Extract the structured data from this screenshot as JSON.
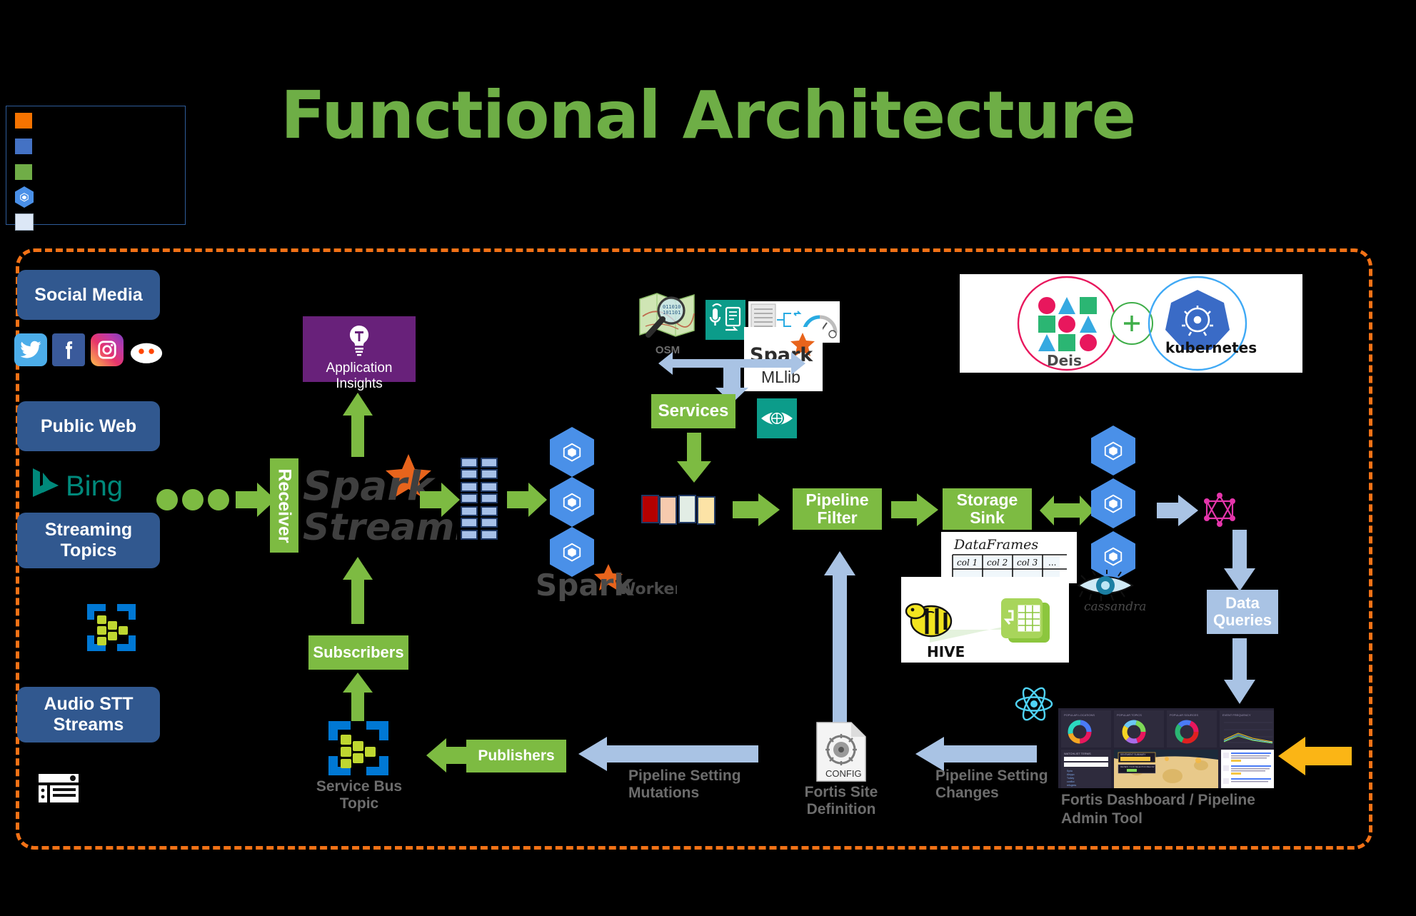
{
  "page": {
    "title": "Functional Architecture",
    "title_color": "#6EAE46",
    "background": "#000000",
    "boundary_color": "#F47216"
  },
  "legend": {
    "name": "legend-box",
    "border_color": "#2E5C9A",
    "swatches": [
      {
        "name": "legend-swatch-orange",
        "color": "#F57300",
        "shape": "square",
        "label": ""
      },
      {
        "name": "legend-swatch-blue",
        "color": "#4472C4",
        "shape": "square",
        "label": ""
      },
      {
        "name": "legend-swatch-green",
        "color": "#70AD47",
        "shape": "square",
        "label": ""
      },
      {
        "name": "legend-swatch-hexagon",
        "color": "#4A90E8",
        "shape": "hexagon",
        "label": ""
      },
      {
        "name": "legend-swatch-pale",
        "color": "#DCE7F6",
        "shape": "square",
        "label": ""
      }
    ]
  },
  "sources": {
    "social_media": {
      "label": "Social Media",
      "color": "#31588F"
    },
    "public_web": {
      "label": "Public Web",
      "color": "#31588F"
    },
    "streaming_topics": {
      "label": "Streaming Topics",
      "color": "#31588F"
    },
    "audio_stt": {
      "label": "Audio STT Streams",
      "color": "#31588F"
    },
    "social_icons": [
      {
        "name": "twitter-icon",
        "label": "Twitter",
        "color": "#4CADE9"
      },
      {
        "name": "facebook-icon",
        "label": "Facebook",
        "color": "#3A5A9B"
      },
      {
        "name": "instagram-icon",
        "label": "Instagram",
        "color": "#D6249F"
      },
      {
        "name": "reddit-icon",
        "label": "Reddit",
        "color": "#FF4500"
      }
    ],
    "bing": {
      "label": "Bing",
      "color": "#00897B"
    },
    "service_bus_icon": {
      "label": "Service Bus",
      "color": "#0078D4"
    },
    "radio_icon": {
      "label": "Radio / Audio Stream",
      "color": "#FFFFFF"
    }
  },
  "ingest": {
    "receiver": {
      "label": "Receiver",
      "color": "#7DBB42"
    },
    "spark_streaming": {
      "line1": "Spark",
      "line2": "Streaming"
    },
    "application_insights": {
      "label": "Application Insights",
      "color": "#68217A",
      "icon": "lightbulb-icon"
    },
    "subscribers": {
      "label": "Subscribers",
      "color": "#7DBB42"
    },
    "service_bus_topic": {
      "label": "Service Bus Topic"
    },
    "publishers": {
      "label": "Publishers",
      "color": "#7DBB42"
    },
    "spark_workers": {
      "label": "Workers",
      "brand": "Spark",
      "node_count": 3
    }
  },
  "services": {
    "box": {
      "label": "Services",
      "color": "#7DBB42"
    },
    "osm": {
      "label": "OSM",
      "name": "osm-map-icon"
    },
    "speech_to_text": {
      "name": "speech-to-text-icon",
      "color": "#0C9C8A"
    },
    "mllib": {
      "brand": "Spark",
      "label": "MLlib",
      "name": "spark-mllib-card"
    },
    "sentiment": {
      "name": "sentiment-gauge-icon"
    },
    "computer_vision": {
      "name": "computer-vision-eye-icon",
      "color": "#0C9C8A"
    }
  },
  "orchestration": {
    "deis": {
      "label": "Deis",
      "circle_color": "#E8175D"
    },
    "plus": {
      "label": "+",
      "color": "#3FAE49"
    },
    "kubernetes": {
      "label": "kubernetes",
      "circle_color": "#3FA9F5",
      "logo_color": "#3A6BC6"
    }
  },
  "processing": {
    "swatches": [
      {
        "name": "data-swatch-red",
        "color": "#B40000"
      },
      {
        "name": "data-swatch-peach",
        "color": "#F6CAAE"
      },
      {
        "name": "data-swatch-mint",
        "color": "#E2EDE5"
      },
      {
        "name": "data-swatch-yellow",
        "color": "#FCE3A6"
      }
    ],
    "pipeline_filter": {
      "label": "Pipeline Filter",
      "color": "#7DBB42"
    },
    "storage_sink": {
      "label": "Storage Sink",
      "color": "#7DBB42"
    },
    "dataframes": {
      "title": "DataFrames",
      "columns": [
        "col 1",
        "col 2",
        "col 3",
        "..."
      ]
    },
    "hive": {
      "label": "HIVE",
      "name": "hive-logo"
    },
    "table_icon": {
      "name": "green-table-icon",
      "color": "#7DBB42"
    },
    "cassandra": {
      "label": "cassandra",
      "name": "cassandra-eye-logo"
    },
    "graphql": {
      "name": "graphql-icon",
      "color": "#E535AB"
    },
    "data_queries": {
      "label": "Data Queries",
      "color": "#A9C3E4"
    }
  },
  "admin": {
    "config": {
      "label": "CONFIG",
      "caption": "Fortis Site Definition"
    },
    "react": {
      "name": "react-icon",
      "color": "#4FD3F5"
    },
    "dashboard_caption": "Fortis Dashboard / Pipeline Admin Tool",
    "dashboard_panels": [
      "POPULAR LOCATIONS",
      "POPULAR TOPICS",
      "POPULAR SOURCES",
      "EVENT FREQUENCY",
      "WATCHLIST TERMS",
      "SENTIMENT SUMMARY"
    ],
    "flows": {
      "pipeline_setting_mutations": "Pipeline Setting Mutations",
      "pipeline_setting_changes": "Pipeline Setting Changes"
    },
    "external_arrow": {
      "name": "user-input-arrow",
      "color": "#FBB515"
    }
  }
}
